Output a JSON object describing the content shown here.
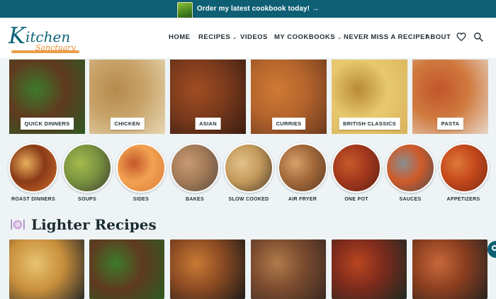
{
  "promo": {
    "text": "Order my latest cookbook today! →",
    "book_icon": "cookbook-cover-icon"
  },
  "logo": {
    "k": "K",
    "rest": "itchen",
    "sub": "Sanctuary"
  },
  "nav": [
    {
      "label": "HOME",
      "has_caret": false
    },
    {
      "label": "RECIPES",
      "has_caret": true
    },
    {
      "label": "VIDEOS",
      "has_caret": false
    },
    {
      "label": "MY COOKBOOKS",
      "has_caret": true
    },
    {
      "label": "NEVER MISS A RECIPE!",
      "has_caret": false
    },
    {
      "label": "ABOUT",
      "has_caret": false
    }
  ],
  "caret": "⌄",
  "header_icons": [
    "heart-icon",
    "search-icon"
  ],
  "categories": [
    {
      "label": "QUICK DINNERS",
      "colors": [
        "#2e5a23",
        "#5f3a1f",
        "#3d7a2b"
      ]
    },
    {
      "label": "CHICKEN",
      "colors": [
        "#e6d7b3",
        "#c9a46a",
        "#b58a4d"
      ]
    },
    {
      "label": "ASIAN",
      "colors": [
        "#3a1c12",
        "#7a3a1c",
        "#a24d22"
      ]
    },
    {
      "label": "CURRIES",
      "colors": [
        "#6c3a1e",
        "#b4642c",
        "#d07a35"
      ]
    },
    {
      "label": "BRITISH CLASSICS",
      "colors": [
        "#d9b25a",
        "#e8c96f",
        "#b88a34"
      ]
    },
    {
      "label": "PASTA",
      "colors": [
        "#e7d7c8",
        "#d07a3f",
        "#c2542a"
      ]
    }
  ],
  "circles": [
    {
      "label": "ROAST DINNERS",
      "colors": [
        "#d2702c",
        "#8a3a17",
        "#e9b05c"
      ]
    },
    {
      "label": "SOUPS",
      "colors": [
        "#3e3a2c",
        "#7a9440",
        "#a7b94c"
      ]
    },
    {
      "label": "SIDES",
      "colors": [
        "#d97a36",
        "#f2a252",
        "#c4582a"
      ]
    },
    {
      "label": "BAKES",
      "colors": [
        "#5a4a3e",
        "#a27a58",
        "#c99a73"
      ]
    },
    {
      "label": "SLOW COOKED",
      "colors": [
        "#4a3a28",
        "#c49a5c",
        "#e1c28a"
      ]
    },
    {
      "label": "AIR FRYER",
      "colors": [
        "#5b3a22",
        "#a2683a",
        "#d9a06a"
      ]
    },
    {
      "label": "ONE POT",
      "colors": [
        "#5a2014",
        "#a2381c",
        "#c65a2a"
      ]
    },
    {
      "label": "SAUCES",
      "colors": [
        "#4a4e52",
        "#d05a2a",
        "#8a8e90"
      ]
    },
    {
      "label": "APPETIZERS",
      "colors": [
        "#7a2a12",
        "#c4481c",
        "#e07a3a"
      ]
    }
  ],
  "section": {
    "title": "Lighter Recipes",
    "icon": "plate-cutlery-icon"
  },
  "recipes": [
    {
      "colors": [
        "#2c2a28",
        "#c9903c",
        "#e7c271"
      ]
    },
    {
      "colors": [
        "#2e5a23",
        "#5f3a1f",
        "#3d7a2b"
      ]
    },
    {
      "colors": [
        "#1e1c1a",
        "#8a4a22",
        "#c97a34"
      ]
    },
    {
      "colors": [
        "#3a2a22",
        "#7a4a2e",
        "#b07a4a"
      ]
    },
    {
      "colors": [
        "#1e2a22",
        "#7a2a1c",
        "#b8451f"
      ]
    },
    {
      "colors": [
        "#2a2420",
        "#8a3e1f",
        "#c9683a"
      ]
    }
  ]
}
